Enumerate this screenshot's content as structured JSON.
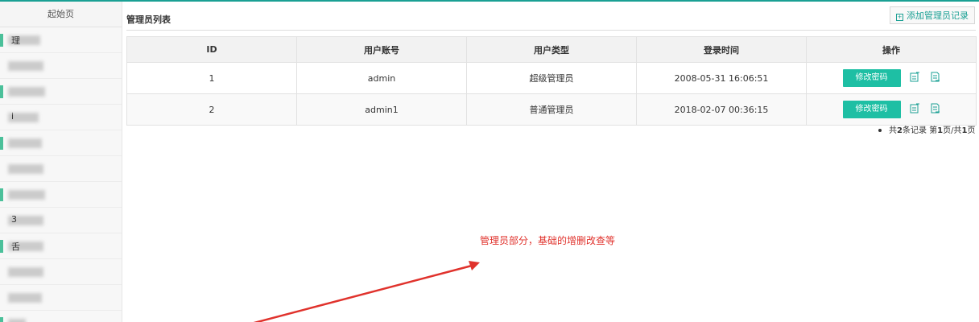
{
  "sidebar": {
    "home_label": "起始页",
    "items": [
      {
        "label": "理",
        "marker": true,
        "blur_width": 40
      },
      {
        "label": "",
        "marker": false,
        "blur_width": 44
      },
      {
        "label": "",
        "marker": true,
        "blur_width": 46
      },
      {
        "label": "i",
        "marker": false,
        "blur_width": 38
      },
      {
        "label": "",
        "marker": true,
        "blur_width": 42
      },
      {
        "label": "",
        "marker": false,
        "blur_width": 44
      },
      {
        "label": "",
        "marker": true,
        "blur_width": 46
      },
      {
        "label": "3",
        "marker": false,
        "blur_width": 44
      },
      {
        "label": "舌",
        "marker": true,
        "blur_width": 44
      },
      {
        "label": "",
        "marker": false,
        "blur_width": 44
      },
      {
        "label": "",
        "marker": false,
        "blur_width": 42
      },
      {
        "label": "",
        "marker": true,
        "blur_width": 22
      }
    ]
  },
  "main": {
    "title": "管理员列表",
    "add_button_label": "添加管理员记录",
    "table": {
      "headers": [
        "ID",
        "用户账号",
        "用户类型",
        "登录时间",
        "操作"
      ],
      "rows": [
        {
          "id": "1",
          "account": "admin",
          "type": "超级管理员",
          "login_time": "2008-05-31 16:06:51",
          "action_label": "修改密码"
        },
        {
          "id": "2",
          "account": "admin1",
          "type": "普通管理员",
          "login_time": "2018-02-07 00:36:15",
          "action_label": "修改密码"
        }
      ]
    },
    "pagination": {
      "prefix": "共",
      "total": "2",
      "records_word": "条记录",
      "page_prefix": "第",
      "current_page": "1",
      "page_sep": "页/共",
      "total_pages": "1",
      "page_suffix": "页"
    }
  },
  "annotation": {
    "text": "管理员部分，基础的增删改查等",
    "color": "#e0322c"
  },
  "colors": {
    "accent": "#1aa094",
    "button": "#1ebfa4"
  },
  "icons": [
    "edit-icon",
    "view-icon",
    "plus-icon"
  ]
}
